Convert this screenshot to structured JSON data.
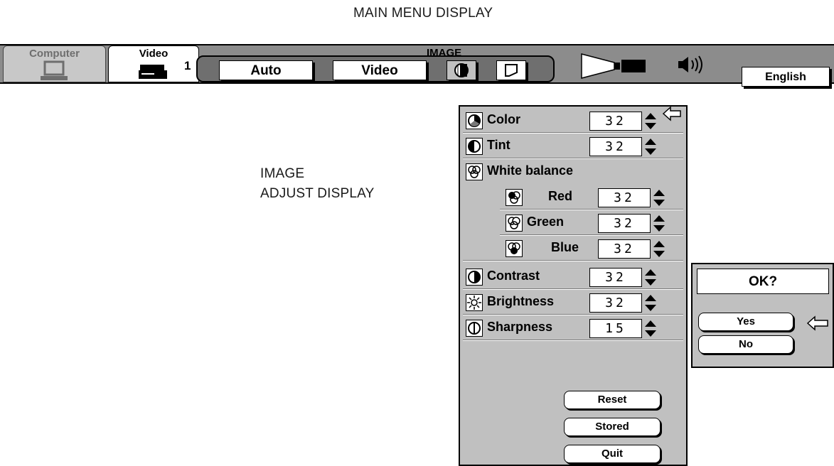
{
  "captions": {
    "main_menu": "MAIN MENU DISPLAY",
    "image_adjust_line1": "IMAGE",
    "image_adjust_line2": "ADJUST DISPLAY"
  },
  "menubar": {
    "tabs": [
      {
        "label": "Computer",
        "icon": "computer-icon"
      },
      {
        "label": "Video",
        "icon": "vcr-icon",
        "number": "1"
      }
    ],
    "image_group": {
      "title": "IMAGE",
      "buttons": [
        "Auto",
        "Video"
      ],
      "icons": [
        "image-adjust-icon",
        "screen-icon"
      ]
    },
    "icons": [
      "projector-icon",
      "speaker-icon"
    ],
    "language": "English"
  },
  "image_adjust": {
    "rows": [
      {
        "label": "Color",
        "value": "32",
        "icon": "color-icon"
      },
      {
        "label": "Tint",
        "value": "32",
        "icon": "tint-icon"
      },
      {
        "label": "White balance",
        "icon": "white-balance-icon"
      },
      {
        "label": "Red",
        "value": "32",
        "icon": "red-icon"
      },
      {
        "label": "Green",
        "value": "32",
        "icon": "green-icon"
      },
      {
        "label": "Blue",
        "value": "32",
        "icon": "blue-icon"
      },
      {
        "label": "Contrast",
        "value": "32",
        "icon": "contrast-icon"
      },
      {
        "label": "Brightness",
        "value": "32",
        "icon": "brightness-icon"
      },
      {
        "label": "Sharpness",
        "value": "15",
        "icon": "sharpness-icon"
      }
    ],
    "buttons": [
      "Reset",
      "Stored",
      "Quit"
    ]
  },
  "confirm": {
    "title": "OK?",
    "yes": "Yes",
    "no": "No"
  },
  "colors": {
    "menubar": "#8c8c8c",
    "panel": "#c0c0c0",
    "group": "#6f6f6f"
  }
}
